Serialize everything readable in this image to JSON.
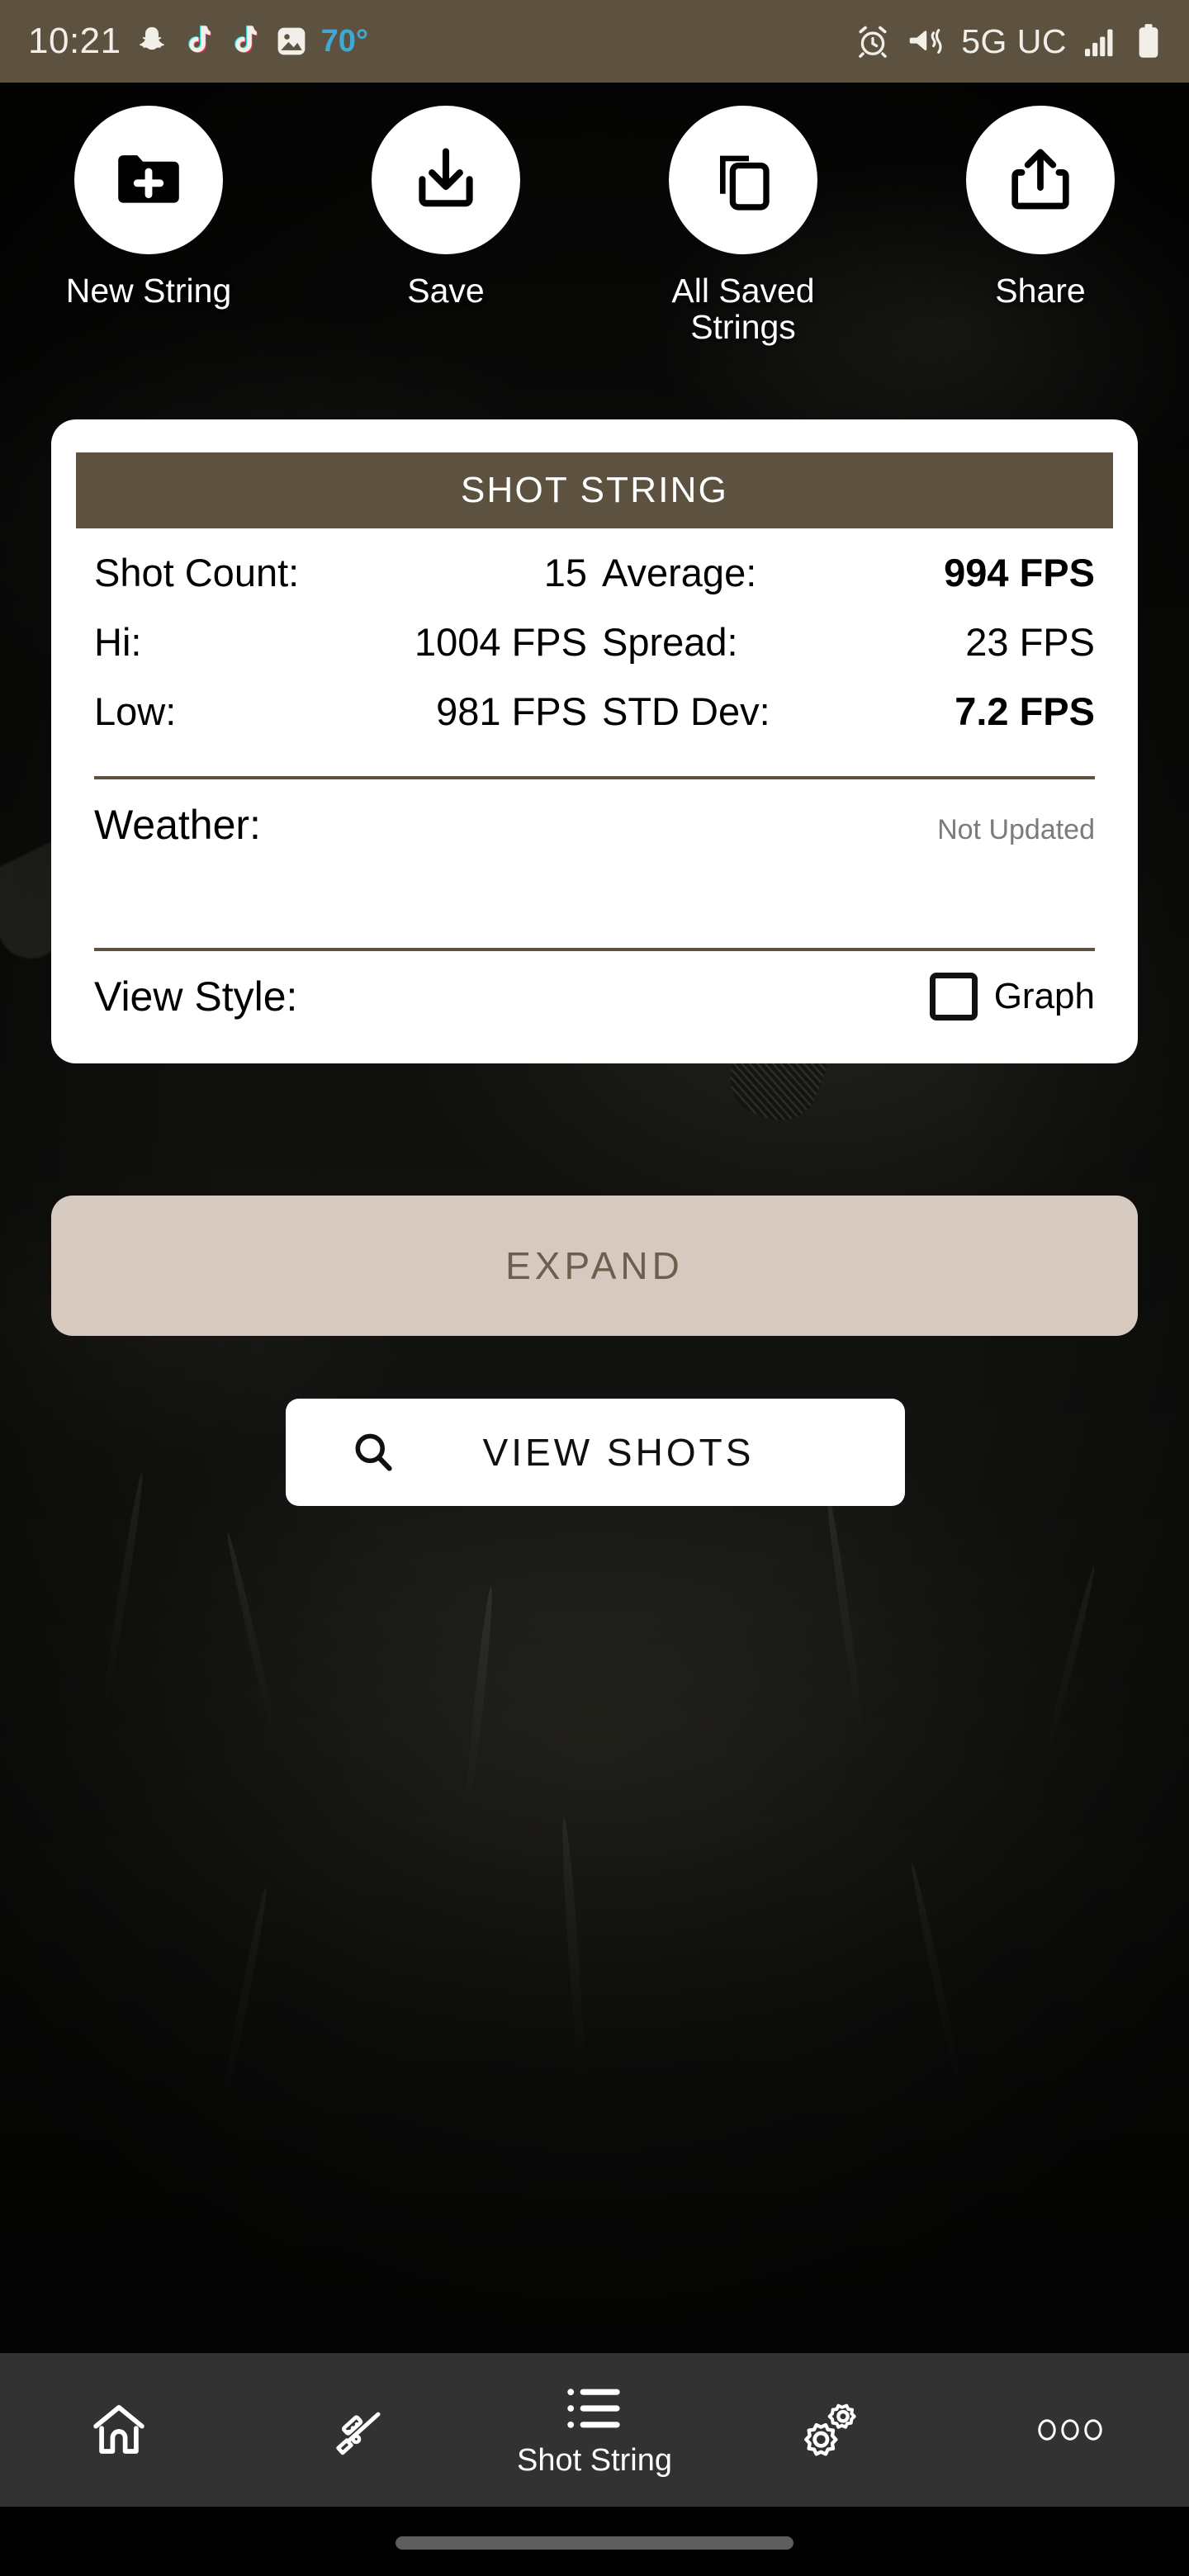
{
  "status_bar": {
    "time": "10:21",
    "temperature": "70°",
    "network": "5G UC",
    "icons": [
      "snapchat-icon",
      "tiktok-icon",
      "tiktok-icon",
      "gallery-icon",
      "alarm-icon",
      "vibrate-icon",
      "signal-icon",
      "battery-icon"
    ],
    "background_color": "#5D5240"
  },
  "actions": [
    {
      "label": "New String",
      "icon": "folder-plus-icon"
    },
    {
      "label": "Save",
      "icon": "download-icon"
    },
    {
      "label": "All Saved Strings",
      "icon": "copy-icon"
    },
    {
      "label": "Share",
      "icon": "share-icon"
    }
  ],
  "card": {
    "header": "SHOT STRING",
    "stats_left": [
      {
        "label": "Shot Count:",
        "value": "15",
        "bold": false
      },
      {
        "label": "Hi:",
        "value": "1004 FPS",
        "bold": false
      },
      {
        "label": "Low:",
        "value": "981 FPS",
        "bold": false
      }
    ],
    "stats_right": [
      {
        "label": "Average:",
        "value": "994 FPS",
        "bold": true
      },
      {
        "label": "Spread:",
        "value": "23 FPS",
        "bold": false
      },
      {
        "label": "STD Dev:",
        "value": "7.2 FPS",
        "bold": true
      }
    ],
    "weather_label": "Weather:",
    "weather_value": "Not Updated",
    "view_style_label": "View Style:",
    "graph_checkbox_label": "Graph",
    "graph_checked": false
  },
  "expand_button": {
    "label": "EXPAND",
    "background": "#D6C9C0",
    "text_color": "#6B5F4D"
  },
  "view_shots_button": {
    "label": "VIEW SHOTS",
    "icon": "search-icon"
  },
  "nav": {
    "items": [
      {
        "label": "",
        "icon": "home-icon",
        "active": false
      },
      {
        "label": "",
        "icon": "rifle-icon",
        "active": false
      },
      {
        "label": "Shot String",
        "icon": "list-icon",
        "active": true
      },
      {
        "label": "",
        "icon": "gears-icon",
        "active": false
      },
      {
        "label": "",
        "icon": "more-icon",
        "active": false
      }
    ]
  }
}
